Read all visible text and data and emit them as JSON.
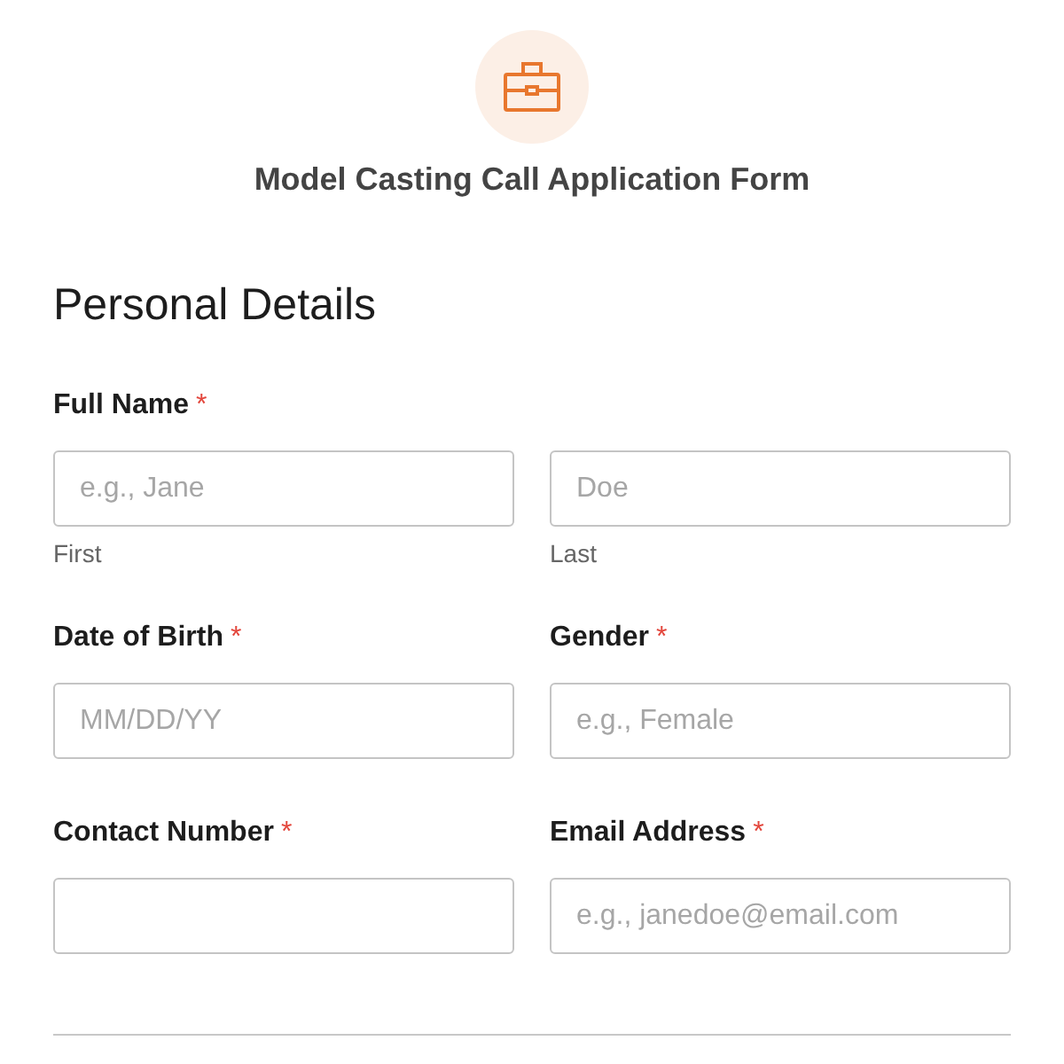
{
  "header": {
    "title": "Model Casting Call Application Form"
  },
  "section": {
    "title": "Personal Details"
  },
  "rows": [
    {
      "fields": [
        {
          "label": "Full Name",
          "required_mark": "*",
          "parts": [
            {
              "placeholder": "e.g., Jane",
              "sublabel": "First"
            },
            {
              "placeholder": "Doe",
              "sublabel": "Last"
            }
          ]
        }
      ]
    },
    {
      "fields": [
        {
          "label": "Date of Birth",
          "required_mark": "*",
          "placeholder": "MM/DD/YY"
        },
        {
          "label": "Gender",
          "required_mark": "*",
          "placeholder": "e.g., Female"
        }
      ]
    },
    {
      "fields": [
        {
          "label": "Contact Number",
          "required_mark": "*"
        },
        {
          "label": "Email Address",
          "required_mark": "*",
          "placeholder": "e.g., janedoe@email.com"
        }
      ]
    }
  ]
}
